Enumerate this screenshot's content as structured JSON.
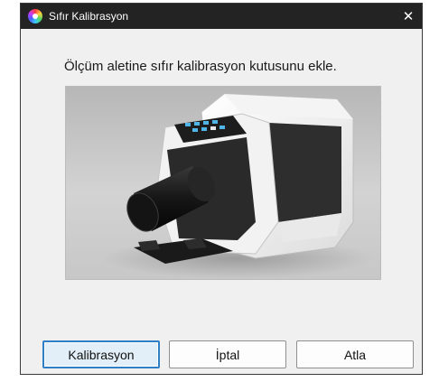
{
  "window": {
    "title": "Sıfır Kalibrasyon",
    "close_symbol": "✕"
  },
  "content": {
    "instruction": "Ölçüm aletine sıfır kalibrasyon kutusunu ekle."
  },
  "buttons": {
    "calibrate_label": "Kalibrasyon",
    "cancel_label": "İptal",
    "skip_label": "Atla"
  },
  "colors": {
    "titlebar": "#232323",
    "dialog_bg": "#f0f0f0",
    "default_button_border": "#2f7fc6",
    "default_button_fill": "#e2eff8"
  },
  "icons": {
    "app": "color-wheel-icon",
    "close": "close-icon"
  }
}
